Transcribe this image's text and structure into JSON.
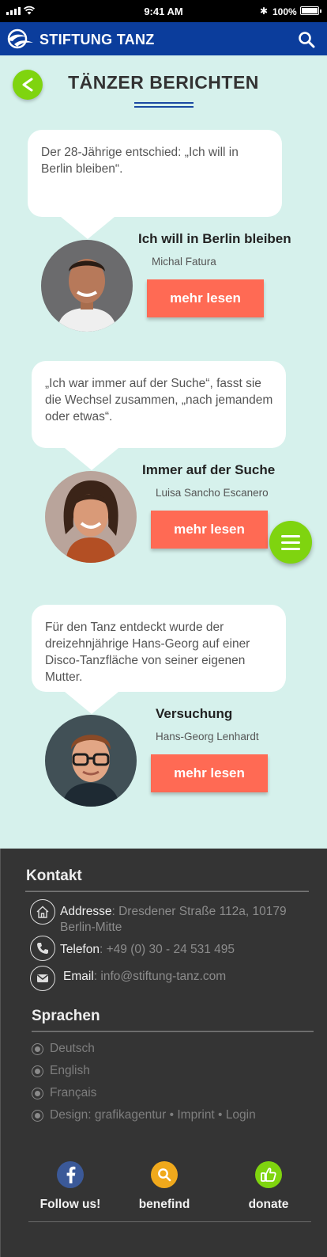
{
  "status_bar": {
    "time": "9:41 AM",
    "battery": "100%"
  },
  "header": {
    "brand": "STIFTUNG TANZ"
  },
  "page": {
    "title": "TÄNZER BERICHTEN"
  },
  "stories": [
    {
      "quote": "Der 28-Jährige entschied: „Ich will in Berlin bleiben“.",
      "title": "Ich will in Berlin bleiben",
      "author": "Michal Fatura",
      "button": "mehr lesen"
    },
    {
      "quote": "„Ich war immer auf der Suche“, fasst sie die Wechsel zusammen, „nach jemandem oder etwas“.",
      "title": "Immer auf der Suche",
      "author": "Luisa Sancho Escanero",
      "button": "mehr lesen"
    },
    {
      "quote": "Für den Tanz entdeckt wurde der dreizehnjährige Hans-Georg auf einer Disco-Tanzfläche von seiner eigenen Mutter.",
      "title": "Versuchung",
      "author": "Hans-Georg Lenhardt",
      "button": "mehr lesen"
    }
  ],
  "footer": {
    "contact_heading": "Kontakt",
    "address_label": "Addresse",
    "address_value": ": Dresdener Straße 112a, 10179 Berlin-Mitte",
    "phone_label": "Telefon",
    "phone_value": ": +49 (0) 30 - 24 531 495",
    "email_label": "Email",
    "email_value": ": info@stiftung-tanz.com",
    "languages_heading": "Sprachen",
    "languages": [
      "Deutsch",
      "English",
      "Français",
      "Design: grafikagentur • Imprint • Login"
    ],
    "social": [
      {
        "label": "Follow us!",
        "color": "#3b5998"
      },
      {
        "label": "benefind",
        "color": "#f0a91c"
      },
      {
        "label": "donate",
        "color": "#7fd40f"
      }
    ]
  },
  "colors": {
    "header": "#0b3d9c",
    "background": "#d6f1ec",
    "accent_green": "#7fd40f",
    "button": "#ff6a54",
    "footer": "#343434"
  }
}
